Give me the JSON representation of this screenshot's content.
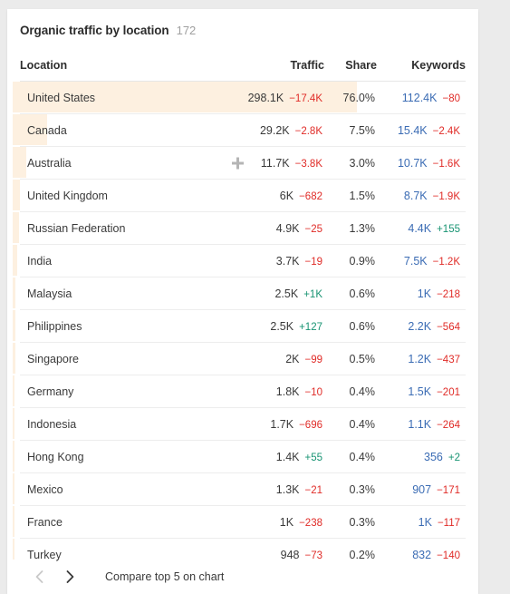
{
  "card": {
    "title": "Organic traffic by location",
    "count": "172"
  },
  "table": {
    "columns": {
      "location": "Location",
      "traffic": "Traffic",
      "share": "Share",
      "keywords": "Keywords"
    },
    "rows": [
      {
        "location": "United States",
        "traffic": "298.1K",
        "traffic_delta": "−17.4K",
        "traffic_delta_dir": "neg",
        "share": "76.0%",
        "share_pct": 76.0,
        "keywords": "112.4K",
        "keywords_delta": "−80",
        "keywords_delta_dir": "neg",
        "plus_icon": false
      },
      {
        "location": "Canada",
        "traffic": "29.2K",
        "traffic_delta": "−2.8K",
        "traffic_delta_dir": "neg",
        "share": "7.5%",
        "share_pct": 7.5,
        "keywords": "15.4K",
        "keywords_delta": "−2.4K",
        "keywords_delta_dir": "neg",
        "plus_icon": false
      },
      {
        "location": "Australia",
        "traffic": "11.7K",
        "traffic_delta": "−3.8K",
        "traffic_delta_dir": "neg",
        "share": "3.0%",
        "share_pct": 3.0,
        "keywords": "10.7K",
        "keywords_delta": "−1.6K",
        "keywords_delta_dir": "neg",
        "plus_icon": true
      },
      {
        "location": "United Kingdom",
        "traffic": "6K",
        "traffic_delta": "−682",
        "traffic_delta_dir": "neg",
        "share": "1.5%",
        "share_pct": 1.5,
        "keywords": "8.7K",
        "keywords_delta": "−1.9K",
        "keywords_delta_dir": "neg",
        "plus_icon": false
      },
      {
        "location": "Russian Federation",
        "traffic": "4.9K",
        "traffic_delta": "−25",
        "traffic_delta_dir": "neg",
        "share": "1.3%",
        "share_pct": 1.3,
        "keywords": "4.4K",
        "keywords_delta": "+155",
        "keywords_delta_dir": "pos",
        "plus_icon": false
      },
      {
        "location": "India",
        "traffic": "3.7K",
        "traffic_delta": "−19",
        "traffic_delta_dir": "neg",
        "share": "0.9%",
        "share_pct": 0.9,
        "keywords": "7.5K",
        "keywords_delta": "−1.2K",
        "keywords_delta_dir": "neg",
        "plus_icon": false
      },
      {
        "location": "Malaysia",
        "traffic": "2.5K",
        "traffic_delta": "+1K",
        "traffic_delta_dir": "pos",
        "share": "0.6%",
        "share_pct": 0.6,
        "keywords": "1K",
        "keywords_delta": "−218",
        "keywords_delta_dir": "neg",
        "plus_icon": false
      },
      {
        "location": "Philippines",
        "traffic": "2.5K",
        "traffic_delta": "+127",
        "traffic_delta_dir": "pos",
        "share": "0.6%",
        "share_pct": 0.6,
        "keywords": "2.2K",
        "keywords_delta": "−564",
        "keywords_delta_dir": "neg",
        "plus_icon": false
      },
      {
        "location": "Singapore",
        "traffic": "2K",
        "traffic_delta": "−99",
        "traffic_delta_dir": "neg",
        "share": "0.5%",
        "share_pct": 0.5,
        "keywords": "1.2K",
        "keywords_delta": "−437",
        "keywords_delta_dir": "neg",
        "plus_icon": false
      },
      {
        "location": "Germany",
        "traffic": "1.8K",
        "traffic_delta": "−10",
        "traffic_delta_dir": "neg",
        "share": "0.4%",
        "share_pct": 0.4,
        "keywords": "1.5K",
        "keywords_delta": "−201",
        "keywords_delta_dir": "neg",
        "plus_icon": false
      },
      {
        "location": "Indonesia",
        "traffic": "1.7K",
        "traffic_delta": "−696",
        "traffic_delta_dir": "neg",
        "share": "0.4%",
        "share_pct": 0.4,
        "keywords": "1.1K",
        "keywords_delta": "−264",
        "keywords_delta_dir": "neg",
        "plus_icon": false
      },
      {
        "location": "Hong Kong",
        "traffic": "1.4K",
        "traffic_delta": "+55",
        "traffic_delta_dir": "pos",
        "share": "0.4%",
        "share_pct": 0.4,
        "keywords": "356",
        "keywords_delta": "+2",
        "keywords_delta_dir": "pos",
        "plus_icon": false
      },
      {
        "location": "Mexico",
        "traffic": "1.3K",
        "traffic_delta": "−21",
        "traffic_delta_dir": "neg",
        "share": "0.3%",
        "share_pct": 0.3,
        "keywords": "907",
        "keywords_delta": "−171",
        "keywords_delta_dir": "neg",
        "plus_icon": false
      },
      {
        "location": "France",
        "traffic": "1K",
        "traffic_delta": "−238",
        "traffic_delta_dir": "neg",
        "share": "0.3%",
        "share_pct": 0.3,
        "keywords": "1K",
        "keywords_delta": "−117",
        "keywords_delta_dir": "neg",
        "plus_icon": false
      },
      {
        "location": "Turkey",
        "traffic": "948",
        "traffic_delta": "−73",
        "traffic_delta_dir": "neg",
        "share": "0.2%",
        "share_pct": 0.2,
        "keywords": "832",
        "keywords_delta": "−140",
        "keywords_delta_dir": "neg",
        "plus_icon": false
      }
    ]
  },
  "footer": {
    "prev_label": "Previous page",
    "next_label": "Next page",
    "compare_label": "Compare top 5 on chart"
  },
  "colors": {
    "bar": "#fdf0e0",
    "negative": "#e02b27",
    "positive": "#199473",
    "link": "#3b6cb4"
  }
}
